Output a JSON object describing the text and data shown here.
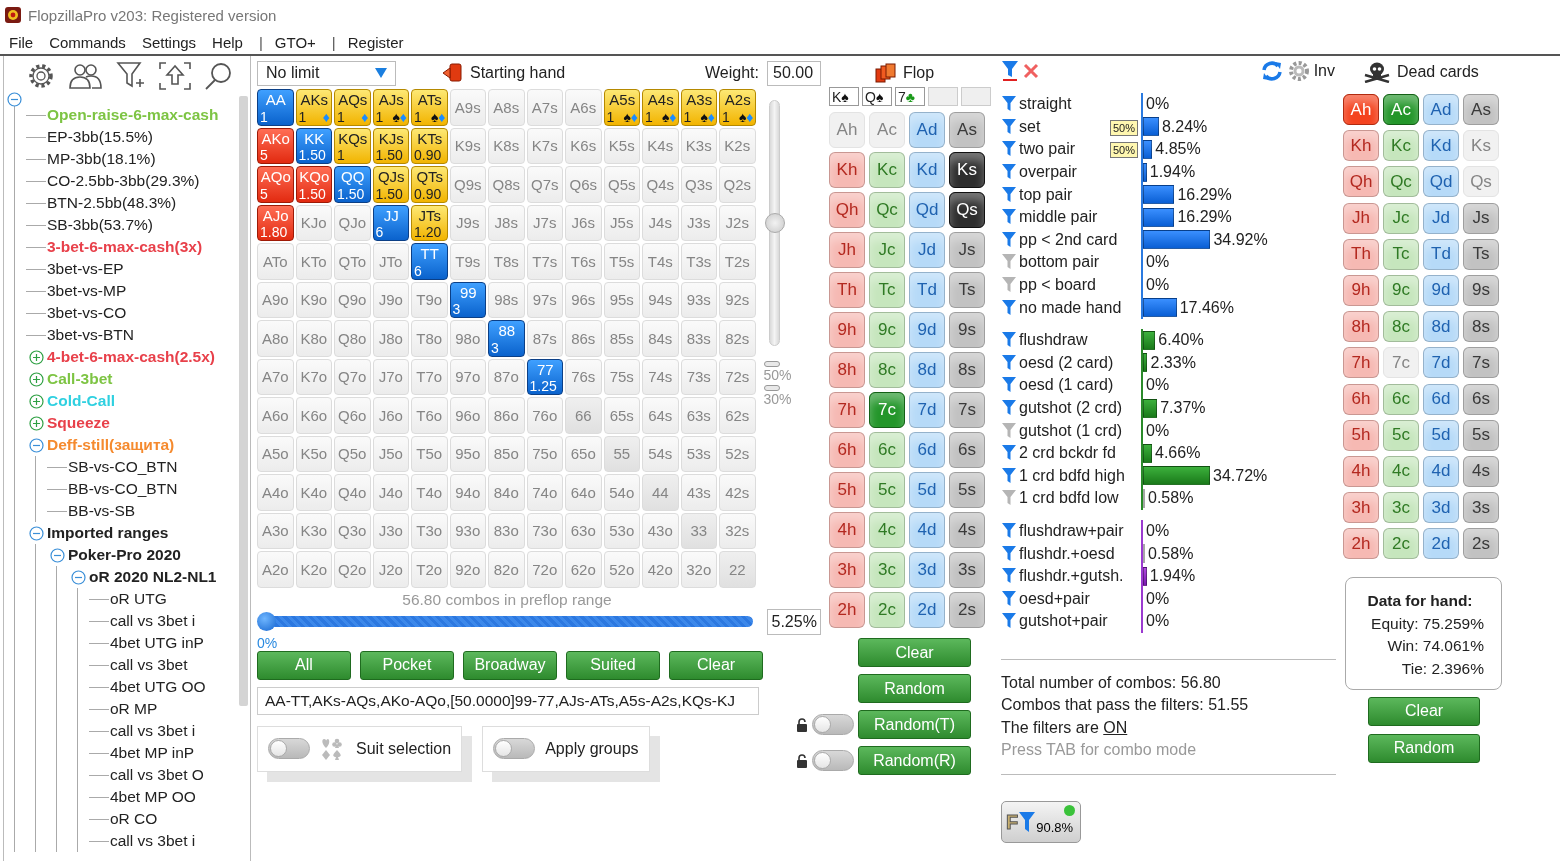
{
  "window": {
    "title": "FlopzillaPro v203: Registered version"
  },
  "menu": [
    {
      "label": "File",
      "kind": "item"
    },
    {
      "label": "Commands",
      "kind": "item"
    },
    {
      "label": "Settings",
      "kind": "item"
    },
    {
      "label": "Help",
      "kind": "item"
    },
    {
      "label": "|",
      "kind": "separator"
    },
    {
      "label": "GTO+",
      "kind": "item"
    },
    {
      "label": "|",
      "kind": "separator"
    },
    {
      "label": "Register",
      "kind": "item"
    }
  ],
  "tree": {
    "expanded": true,
    "children": [
      {
        "label": "Open-raise-6-max-cash",
        "kind": "group",
        "color": "#7dc443"
      },
      {
        "label": "EP-3bb(15.5%)",
        "kind": "range"
      },
      {
        "label": "MP-3bb(18.1%)",
        "kind": "range"
      },
      {
        "label": "CO-2.5bb-3bb(29.3%)",
        "kind": "range"
      },
      {
        "label": "BTN-2.5bb(48.3%)",
        "kind": "range"
      },
      {
        "label": "SB-3bb(53.7%)",
        "kind": "range"
      },
      {
        "label": "3-bet-6-max-cash(3x)",
        "kind": "group",
        "color": "#e8404a"
      },
      {
        "label": "3bet-vs-EP",
        "kind": "range"
      },
      {
        "label": "3bet-vs-MP",
        "kind": "range"
      },
      {
        "label": "3bet-vs-CO",
        "kind": "range"
      },
      {
        "label": "3bet-vs-BTN",
        "kind": "range"
      },
      {
        "label": "4-bet-6-max-cash(2.5x)",
        "kind": "group",
        "color": "#e8404a",
        "expanded": false
      },
      {
        "label": "Call-3bet",
        "kind": "group",
        "color": "#7dc443",
        "expanded": false
      },
      {
        "label": "Cold-Call",
        "kind": "group",
        "color": "#2fd0e0",
        "expanded": false
      },
      {
        "label": "Squeeze",
        "kind": "group",
        "color": "#e8404a",
        "expanded": false
      },
      {
        "label": "Deff-still(защита)",
        "kind": "group",
        "color": "#f58a2e",
        "expanded": true,
        "children": [
          {
            "label": "SB-vs-CO_BTN",
            "kind": "range"
          },
          {
            "label": "BB-vs-CO_BTN",
            "kind": "range"
          },
          {
            "label": "BB-vs-SB",
            "kind": "range"
          }
        ]
      },
      {
        "label": "Imported ranges",
        "kind": "group",
        "color": "#222222",
        "expanded": true,
        "children": [
          {
            "label": "Poker-Pro 2020",
            "kind": "group",
            "color": "#222222",
            "expanded": true,
            "children": [
              {
                "label": "oR 2020 NL2-NL1",
                "kind": "group",
                "color": "#222222",
                "expanded": true,
                "children": [
                  {
                    "label": "oR UTG",
                    "kind": "range"
                  },
                  {
                    "label": "call vs 3bet i",
                    "kind": "range"
                  },
                  {
                    "label": "4bet UTG inP",
                    "kind": "range"
                  },
                  {
                    "label": "call  vs 3bet",
                    "kind": "range"
                  },
                  {
                    "label": "4bet UTG OO",
                    "kind": "range"
                  },
                  {
                    "label": "oR MP",
                    "kind": "range"
                  },
                  {
                    "label": "call vs 3bet i",
                    "kind": "range"
                  },
                  {
                    "label": "4bet MP inP",
                    "kind": "range"
                  },
                  {
                    "label": "call vs 3bet O",
                    "kind": "range"
                  },
                  {
                    "label": "4bet MP OO",
                    "kind": "range"
                  },
                  {
                    "label": "oR CO",
                    "kind": "range"
                  },
                  {
                    "label": "call vs 3bet i",
                    "kind": "range"
                  }
                ]
              }
            ]
          }
        ]
      }
    ]
  },
  "hands": {
    "game": "No limit",
    "title": "Starting hand",
    "weight_label": "Weight:",
    "weight": "50.00",
    "grid": [
      [
        {
          "label": "AA",
          "in_range": true,
          "weight": "1"
        },
        {
          "label": "AKs",
          "in_range": true,
          "weight": "1",
          "suits": [
            {
              "glyph": "♦",
              "kind": "diamonds"
            }
          ]
        },
        {
          "label": "AQs",
          "in_range": true,
          "weight": "1",
          "suits": [
            {
              "glyph": "♦",
              "kind": "diamonds"
            }
          ]
        },
        {
          "label": "AJs",
          "in_range": true,
          "weight": "1",
          "suits": [
            {
              "glyph": "♠",
              "kind": "spades"
            },
            {
              "glyph": "♦",
              "kind": "diamonds"
            }
          ]
        },
        {
          "label": "ATs",
          "in_range": true,
          "weight": "1",
          "suits": [
            {
              "glyph": "♠",
              "kind": "spades"
            },
            {
              "glyph": "♦",
              "kind": "diamonds"
            }
          ]
        },
        {
          "label": "A9s",
          "in_range": false
        },
        {
          "label": "A8s",
          "in_range": false
        },
        {
          "label": "A7s",
          "in_range": false
        },
        {
          "label": "A6s",
          "in_range": false
        },
        {
          "label": "A5s",
          "in_range": true,
          "weight": "1",
          "suits": [
            {
              "glyph": "♠",
              "kind": "spades"
            },
            {
              "glyph": "♦",
              "kind": "diamonds"
            }
          ]
        },
        {
          "label": "A4s",
          "in_range": true,
          "weight": "1",
          "suits": [
            {
              "glyph": "♠",
              "kind": "spades"
            },
            {
              "glyph": "♦",
              "kind": "diamonds"
            }
          ]
        },
        {
          "label": "A3s",
          "in_range": true,
          "weight": "1",
          "suits": [
            {
              "glyph": "♠",
              "kind": "spades"
            },
            {
              "glyph": "♦",
              "kind": "diamonds"
            }
          ]
        },
        {
          "label": "A2s",
          "in_range": true,
          "weight": "1",
          "suits": [
            {
              "glyph": "♠",
              "kind": "spades"
            },
            {
              "glyph": "♦",
              "kind": "diamonds"
            }
          ]
        }
      ],
      [
        {
          "label": "AKo",
          "in_range": true,
          "weight": "5"
        },
        {
          "label": "KK",
          "in_range": true,
          "weight": "1.50"
        },
        {
          "label": "KQs",
          "in_range": true,
          "weight": "1"
        },
        {
          "label": "KJs",
          "in_range": true,
          "weight": "1.50"
        },
        {
          "label": "KTs",
          "in_range": true,
          "weight": "0.90"
        },
        {
          "label": "K9s",
          "in_range": false
        },
        {
          "label": "K8s",
          "in_range": false
        },
        {
          "label": "K7s",
          "in_range": false
        },
        {
          "label": "K6s",
          "in_range": false
        },
        {
          "label": "K5s",
          "in_range": false
        },
        {
          "label": "K4s",
          "in_range": false
        },
        {
          "label": "K3s",
          "in_range": false
        },
        {
          "label": "K2s",
          "in_range": false
        }
      ],
      [
        {
          "label": "AQo",
          "in_range": true,
          "weight": "5"
        },
        {
          "label": "KQo",
          "in_range": true,
          "weight": "1.50"
        },
        {
          "label": "QQ",
          "in_range": true,
          "weight": "1.50"
        },
        {
          "label": "QJs",
          "in_range": true,
          "weight": "1.50"
        },
        {
          "label": "QTs",
          "in_range": true,
          "weight": "0.90"
        },
        {
          "label": "Q9s",
          "in_range": false
        },
        {
          "label": "Q8s",
          "in_range": false
        },
        {
          "label": "Q7s",
          "in_range": false
        },
        {
          "label": "Q6s",
          "in_range": false
        },
        {
          "label": "Q5s",
          "in_range": false
        },
        {
          "label": "Q4s",
          "in_range": false
        },
        {
          "label": "Q3s",
          "in_range": false
        },
        {
          "label": "Q2s",
          "in_range": false
        }
      ],
      [
        {
          "label": "AJo",
          "in_range": true,
          "weight": "1.80"
        },
        {
          "label": "KJo",
          "in_range": false
        },
        {
          "label": "QJo",
          "in_range": false
        },
        {
          "label": "JJ",
          "in_range": true,
          "weight": "6"
        },
        {
          "label": "JTs",
          "in_range": true,
          "weight": "1.20"
        },
        {
          "label": "J9s",
          "in_range": false
        },
        {
          "label": "J8s",
          "in_range": false
        },
        {
          "label": "J7s",
          "in_range": false
        },
        {
          "label": "J6s",
          "in_range": false
        },
        {
          "label": "J5s",
          "in_range": false
        },
        {
          "label": "J4s",
          "in_range": false
        },
        {
          "label": "J3s",
          "in_range": false
        },
        {
          "label": "J2s",
          "in_range": false
        }
      ],
      [
        {
          "label": "ATo",
          "in_range": false
        },
        {
          "label": "KTo",
          "in_range": false
        },
        {
          "label": "QTo",
          "in_range": false
        },
        {
          "label": "JTo",
          "in_range": false
        },
        {
          "label": "TT",
          "in_range": true,
          "weight": "6"
        },
        {
          "label": "T9s",
          "in_range": false
        },
        {
          "label": "T8s",
          "in_range": false
        },
        {
          "label": "T7s",
          "in_range": false
        },
        {
          "label": "T6s",
          "in_range": false
        },
        {
          "label": "T5s",
          "in_range": false
        },
        {
          "label": "T4s",
          "in_range": false
        },
        {
          "label": "T3s",
          "in_range": false
        },
        {
          "label": "T2s",
          "in_range": false
        }
      ],
      [
        {
          "label": "A9o",
          "in_range": false
        },
        {
          "label": "K9o",
          "in_range": false
        },
        {
          "label": "Q9o",
          "in_range": false
        },
        {
          "label": "J9o",
          "in_range": false
        },
        {
          "label": "T9o",
          "in_range": false
        },
        {
          "label": "99",
          "in_range": true,
          "weight": "3"
        },
        {
          "label": "98s",
          "in_range": false
        },
        {
          "label": "97s",
          "in_range": false
        },
        {
          "label": "96s",
          "in_range": false
        },
        {
          "label": "95s",
          "in_range": false
        },
        {
          "label": "94s",
          "in_range": false
        },
        {
          "label": "93s",
          "in_range": false
        },
        {
          "label": "92s",
          "in_range": false
        }
      ],
      [
        {
          "label": "A8o",
          "in_range": false
        },
        {
          "label": "K8o",
          "in_range": false
        },
        {
          "label": "Q8o",
          "in_range": false
        },
        {
          "label": "J8o",
          "in_range": false
        },
        {
          "label": "T8o",
          "in_range": false
        },
        {
          "label": "98o",
          "in_range": false
        },
        {
          "label": "88",
          "in_range": true,
          "weight": "3"
        },
        {
          "label": "87s",
          "in_range": false
        },
        {
          "label": "86s",
          "in_range": false
        },
        {
          "label": "85s",
          "in_range": false
        },
        {
          "label": "84s",
          "in_range": false
        },
        {
          "label": "83s",
          "in_range": false
        },
        {
          "label": "82s",
          "in_range": false
        }
      ],
      [
        {
          "label": "A7o",
          "in_range": false
        },
        {
          "label": "K7o",
          "in_range": false
        },
        {
          "label": "Q7o",
          "in_range": false
        },
        {
          "label": "J7o",
          "in_range": false
        },
        {
          "label": "T7o",
          "in_range": false
        },
        {
          "label": "97o",
          "in_range": false
        },
        {
          "label": "87o",
          "in_range": false
        },
        {
          "label": "77",
          "in_range": true,
          "weight": "1.25"
        },
        {
          "label": "76s",
          "in_range": false
        },
        {
          "label": "75s",
          "in_range": false
        },
        {
          "label": "74s",
          "in_range": false
        },
        {
          "label": "73s",
          "in_range": false
        },
        {
          "label": "72s",
          "in_range": false
        }
      ],
      [
        {
          "label": "A6o",
          "in_range": false
        },
        {
          "label": "K6o",
          "in_range": false
        },
        {
          "label": "Q6o",
          "in_range": false
        },
        {
          "label": "J6o",
          "in_range": false
        },
        {
          "label": "T6o",
          "in_range": false
        },
        {
          "label": "96o",
          "in_range": false
        },
        {
          "label": "86o",
          "in_range": false
        },
        {
          "label": "76o",
          "in_range": false
        },
        {
          "label": "66",
          "in_range": false
        },
        {
          "label": "65s",
          "in_range": false
        },
        {
          "label": "64s",
          "in_range": false
        },
        {
          "label": "63s",
          "in_range": false
        },
        {
          "label": "62s",
          "in_range": false
        }
      ],
      [
        {
          "label": "A5o",
          "in_range": false
        },
        {
          "label": "K5o",
          "in_range": false
        },
        {
          "label": "Q5o",
          "in_range": false
        },
        {
          "label": "J5o",
          "in_range": false
        },
        {
          "label": "T5o",
          "in_range": false
        },
        {
          "label": "95o",
          "in_range": false
        },
        {
          "label": "85o",
          "in_range": false
        },
        {
          "label": "75o",
          "in_range": false
        },
        {
          "label": "65o",
          "in_range": false
        },
        {
          "label": "55",
          "in_range": false
        },
        {
          "label": "54s",
          "in_range": false
        },
        {
          "label": "53s",
          "in_range": false
        },
        {
          "label": "52s",
          "in_range": false
        }
      ],
      [
        {
          "label": "A4o",
          "in_range": false
        },
        {
          "label": "K4o",
          "in_range": false
        },
        {
          "label": "Q4o",
          "in_range": false
        },
        {
          "label": "J4o",
          "in_range": false
        },
        {
          "label": "T4o",
          "in_range": false
        },
        {
          "label": "94o",
          "in_range": false
        },
        {
          "label": "84o",
          "in_range": false
        },
        {
          "label": "74o",
          "in_range": false
        },
        {
          "label": "64o",
          "in_range": false
        },
        {
          "label": "54o",
          "in_range": false
        },
        {
          "label": "44",
          "in_range": false
        },
        {
          "label": "43s",
          "in_range": false
        },
        {
          "label": "42s",
          "in_range": false
        }
      ],
      [
        {
          "label": "A3o",
          "in_range": false
        },
        {
          "label": "K3o",
          "in_range": false
        },
        {
          "label": "Q3o",
          "in_range": false
        },
        {
          "label": "J3o",
          "in_range": false
        },
        {
          "label": "T3o",
          "in_range": false
        },
        {
          "label": "93o",
          "in_range": false
        },
        {
          "label": "83o",
          "in_range": false
        },
        {
          "label": "73o",
          "in_range": false
        },
        {
          "label": "63o",
          "in_range": false
        },
        {
          "label": "53o",
          "in_range": false
        },
        {
          "label": "43o",
          "in_range": false
        },
        {
          "label": "33",
          "in_range": false
        },
        {
          "label": "32s",
          "in_range": false
        }
      ],
      [
        {
          "label": "A2o",
          "in_range": false
        },
        {
          "label": "K2o",
          "in_range": false
        },
        {
          "label": "Q2o",
          "in_range": false
        },
        {
          "label": "J2o",
          "in_range": false
        },
        {
          "label": "T2o",
          "in_range": false
        },
        {
          "label": "92o",
          "in_range": false
        },
        {
          "label": "82o",
          "in_range": false
        },
        {
          "label": "72o",
          "in_range": false
        },
        {
          "label": "62o",
          "in_range": false
        },
        {
          "label": "52o",
          "in_range": false
        },
        {
          "label": "42o",
          "in_range": false
        },
        {
          "label": "32o",
          "in_range": false
        },
        {
          "label": "22",
          "in_range": false
        }
      ]
    ],
    "vertical_slider": {
      "level": 0.5
    },
    "legend": [
      {
        "label": "50%"
      },
      {
        "label": "30%"
      }
    ],
    "combos_text": "56.80 combos in preflop range",
    "range_slider": {
      "level": 0,
      "min_label": "0%"
    },
    "range_percent": "5.25%",
    "buttons": [
      "All",
      "Pocket",
      "Broadway",
      "Suited",
      "Clear"
    ],
    "range_text": "AA-TT,AKs-AQs,AKo-AQo,[50.0000]99-77,AJs-ATs,A5s-A2s,KQs-KJ",
    "toggles": [
      {
        "label": "Suit selection",
        "on": false,
        "kind": "suits"
      },
      {
        "label": "Apply groups",
        "on": false,
        "kind": "plain"
      }
    ]
  },
  "flop": {
    "title": "Flop",
    "board": [
      {
        "kind": "card",
        "rank": "K",
        "suit": "♠",
        "color": "#111111"
      },
      {
        "kind": "card",
        "rank": "Q",
        "suit": "♠",
        "color": "#111111"
      },
      {
        "kind": "card",
        "rank": "7",
        "suit": "♣",
        "color": "#1a9a1a"
      },
      {
        "kind": "empty"
      },
      {
        "kind": "empty"
      }
    ],
    "cards": [
      [
        {
          "label": "Ah",
          "selected": false,
          "disabled": true
        },
        {
          "label": "Ac",
          "selected": false,
          "disabled": true
        },
        {
          "label": "Ad",
          "selected": false,
          "disabled": false
        },
        {
          "label": "As",
          "selected": false,
          "disabled": false
        }
      ],
      [
        {
          "label": "Kh",
          "selected": false,
          "disabled": false
        },
        {
          "label": "Kc",
          "selected": false,
          "disabled": false
        },
        {
          "label": "Kd",
          "selected": false,
          "disabled": false
        },
        {
          "label": "Ks",
          "selected": true,
          "disabled": false
        }
      ],
      [
        {
          "label": "Qh",
          "selected": false,
          "disabled": false
        },
        {
          "label": "Qc",
          "selected": false,
          "disabled": false
        },
        {
          "label": "Qd",
          "selected": false,
          "disabled": false
        },
        {
          "label": "Qs",
          "selected": true,
          "disabled": false
        }
      ],
      [
        {
          "label": "Jh",
          "selected": false,
          "disabled": false
        },
        {
          "label": "Jc",
          "selected": false,
          "disabled": false
        },
        {
          "label": "Jd",
          "selected": false,
          "disabled": false
        },
        {
          "label": "Js",
          "selected": false,
          "disabled": false
        }
      ],
      [
        {
          "label": "Th",
          "selected": false,
          "disabled": false
        },
        {
          "label": "Tc",
          "selected": false,
          "disabled": false
        },
        {
          "label": "Td",
          "selected": false,
          "disabled": false
        },
        {
          "label": "Ts",
          "selected": false,
          "disabled": false
        }
      ],
      [
        {
          "label": "9h",
          "selected": false,
          "disabled": false
        },
        {
          "label": "9c",
          "selected": false,
          "disabled": false
        },
        {
          "label": "9d",
          "selected": false,
          "disabled": false
        },
        {
          "label": "9s",
          "selected": false,
          "disabled": false
        }
      ],
      [
        {
          "label": "8h",
          "selected": false,
          "disabled": false
        },
        {
          "label": "8c",
          "selected": false,
          "disabled": false
        },
        {
          "label": "8d",
          "selected": false,
          "disabled": false
        },
        {
          "label": "8s",
          "selected": false,
          "disabled": false
        }
      ],
      [
        {
          "label": "7h",
          "selected": false,
          "disabled": false
        },
        {
          "label": "7c",
          "selected": true,
          "disabled": false
        },
        {
          "label": "7d",
          "selected": false,
          "disabled": false
        },
        {
          "label": "7s",
          "selected": false,
          "disabled": false
        }
      ],
      [
        {
          "label": "6h",
          "selected": false,
          "disabled": false
        },
        {
          "label": "6c",
          "selected": false,
          "disabled": false
        },
        {
          "label": "6d",
          "selected": false,
          "disabled": false
        },
        {
          "label": "6s",
          "selected": false,
          "disabled": false
        }
      ],
      [
        {
          "label": "5h",
          "selected": false,
          "disabled": false
        },
        {
          "label": "5c",
          "selected": false,
          "disabled": false
        },
        {
          "label": "5d",
          "selected": false,
          "disabled": false
        },
        {
          "label": "5s",
          "selected": false,
          "disabled": false
        }
      ],
      [
        {
          "label": "4h",
          "selected": false,
          "disabled": false
        },
        {
          "label": "4c",
          "selected": false,
          "disabled": false
        },
        {
          "label": "4d",
          "selected": false,
          "disabled": false
        },
        {
          "label": "4s",
          "selected": false,
          "disabled": false
        }
      ],
      [
        {
          "label": "3h",
          "selected": false,
          "disabled": false
        },
        {
          "label": "3c",
          "selected": false,
          "disabled": false
        },
        {
          "label": "3d",
          "selected": false,
          "disabled": false
        },
        {
          "label": "3s",
          "selected": false,
          "disabled": false
        }
      ],
      [
        {
          "label": "2h",
          "selected": false,
          "disabled": false
        },
        {
          "label": "2c",
          "selected": false,
          "disabled": false
        },
        {
          "label": "2d",
          "selected": false,
          "disabled": false
        },
        {
          "label": "2s",
          "selected": false,
          "disabled": false
        }
      ]
    ],
    "buttons": [
      {
        "label": "Clear"
      },
      {
        "label": "Random"
      },
      {
        "label": "Random(T)",
        "toggle": {
          "on": false
        }
      },
      {
        "label": "Random(R)",
        "toggle": {
          "on": false
        }
      }
    ]
  },
  "filters": {
    "inv_label": "Inv",
    "groups": [
      {
        "kind": "made",
        "items": [
          {
            "label": "straight",
            "active": true,
            "value": "0%"
          },
          {
            "label": "set",
            "active": true,
            "badge": "50%",
            "value": "8.24%",
            "level": 0.0824
          },
          {
            "label": "two pair",
            "active": true,
            "badge": "50%",
            "value": "4.85%",
            "level": 0.0485
          },
          {
            "label": "overpair",
            "active": true,
            "value": "1.94%",
            "level": 0.0194
          },
          {
            "label": "top pair",
            "active": true,
            "value": "16.29%",
            "level": 0.1629
          },
          {
            "label": "middle pair",
            "active": true,
            "value": "16.29%",
            "level": 0.1629
          },
          {
            "label": "pp < 2nd card",
            "active": true,
            "value": "34.92%",
            "level": 0.3492
          },
          {
            "label": "bottom pair",
            "active": false,
            "value": "0%"
          },
          {
            "label": "pp < board",
            "active": false,
            "value": "0%"
          },
          {
            "label": "no made hand",
            "active": true,
            "value": "17.46%",
            "level": 0.1746
          }
        ]
      },
      {
        "kind": "draw",
        "items": [
          {
            "label": "flushdraw",
            "active": true,
            "value": "6.40%",
            "level": 0.064
          },
          {
            "label": "oesd (2 card)",
            "active": true,
            "value": "2.33%",
            "level": 0.0233
          },
          {
            "label": "oesd (1 card)",
            "active": true,
            "value": "0%"
          },
          {
            "label": "gutshot (2 crd)",
            "active": true,
            "value": "7.37%",
            "level": 0.0737
          },
          {
            "label": "gutshot (1 crd)",
            "active": false,
            "value": "0%"
          },
          {
            "label": "2 crd bckdr fd",
            "active": true,
            "value": "4.66%",
            "level": 0.0466
          },
          {
            "label": "1 crd bdfd high",
            "active": true,
            "value": "34.72%",
            "level": 0.3472
          },
          {
            "label": "1 crd bdfd low",
            "active": false,
            "value": "0.58%",
            "level": 0.0058
          }
        ]
      },
      {
        "kind": "combo",
        "items": [
          {
            "label": "flushdraw+pair",
            "active": true,
            "value": "0%"
          },
          {
            "label": "flushdr.+oesd",
            "active": true,
            "value": "0.58%",
            "level": 0.0058
          },
          {
            "label": "flushdr.+gutsh.",
            "active": true,
            "value": "1.94%",
            "level": 0.0194
          },
          {
            "label": "oesd+pair",
            "active": true,
            "value": "0%"
          },
          {
            "label": "gutshot+pair",
            "active": true,
            "value": "0%"
          }
        ]
      }
    ],
    "summary": [
      "Total number of combos: 56.80",
      "Combos that pass the filters: 51.55"
    ],
    "state_text": "The filters are",
    "state_link": "ON",
    "hint": "Press TAB for combo mode",
    "filter_button": {
      "label": "F",
      "value": "90.8%",
      "on": true
    }
  },
  "dead": {
    "title": "Dead cards",
    "cards": [
      [
        {
          "label": "Ah",
          "selected": true,
          "disabled": false
        },
        {
          "label": "Ac",
          "selected": true,
          "disabled": false
        },
        {
          "label": "Ad",
          "selected": false,
          "disabled": false
        },
        {
          "label": "As",
          "selected": false,
          "disabled": false
        }
      ],
      [
        {
          "label": "Kh",
          "selected": false,
          "disabled": false
        },
        {
          "label": "Kc",
          "selected": false,
          "disabled": false
        },
        {
          "label": "Kd",
          "selected": false,
          "disabled": false
        },
        {
          "label": "Ks",
          "selected": false,
          "disabled": true
        }
      ],
      [
        {
          "label": "Qh",
          "selected": false,
          "disabled": false
        },
        {
          "label": "Qc",
          "selected": false,
          "disabled": false
        },
        {
          "label": "Qd",
          "selected": false,
          "disabled": false
        },
        {
          "label": "Qs",
          "selected": false,
          "disabled": true
        }
      ],
      [
        {
          "label": "Jh",
          "selected": false,
          "disabled": false
        },
        {
          "label": "Jc",
          "selected": false,
          "disabled": false
        },
        {
          "label": "Jd",
          "selected": false,
          "disabled": false
        },
        {
          "label": "Js",
          "selected": false,
          "disabled": false
        }
      ],
      [
        {
          "label": "Th",
          "selected": false,
          "disabled": false
        },
        {
          "label": "Tc",
          "selected": false,
          "disabled": false
        },
        {
          "label": "Td",
          "selected": false,
          "disabled": false
        },
        {
          "label": "Ts",
          "selected": false,
          "disabled": false
        }
      ],
      [
        {
          "label": "9h",
          "selected": false,
          "disabled": false
        },
        {
          "label": "9c",
          "selected": false,
          "disabled": false
        },
        {
          "label": "9d",
          "selected": false,
          "disabled": false
        },
        {
          "label": "9s",
          "selected": false,
          "disabled": false
        }
      ],
      [
        {
          "label": "8h",
          "selected": false,
          "disabled": false
        },
        {
          "label": "8c",
          "selected": false,
          "disabled": false
        },
        {
          "label": "8d",
          "selected": false,
          "disabled": false
        },
        {
          "label": "8s",
          "selected": false,
          "disabled": false
        }
      ],
      [
        {
          "label": "7h",
          "selected": false,
          "disabled": false
        },
        {
          "label": "7c",
          "selected": false,
          "disabled": true
        },
        {
          "label": "7d",
          "selected": false,
          "disabled": false
        },
        {
          "label": "7s",
          "selected": false,
          "disabled": false
        }
      ],
      [
        {
          "label": "6h",
          "selected": false,
          "disabled": false
        },
        {
          "label": "6c",
          "selected": false,
          "disabled": false
        },
        {
          "label": "6d",
          "selected": false,
          "disabled": false
        },
        {
          "label": "6s",
          "selected": false,
          "disabled": false
        }
      ],
      [
        {
          "label": "5h",
          "selected": false,
          "disabled": false
        },
        {
          "label": "5c",
          "selected": false,
          "disabled": false
        },
        {
          "label": "5d",
          "selected": false,
          "disabled": false
        },
        {
          "label": "5s",
          "selected": false,
          "disabled": false
        }
      ],
      [
        {
          "label": "4h",
          "selected": false,
          "disabled": false
        },
        {
          "label": "4c",
          "selected": false,
          "disabled": false
        },
        {
          "label": "4d",
          "selected": false,
          "disabled": false
        },
        {
          "label": "4s",
          "selected": false,
          "disabled": false
        }
      ],
      [
        {
          "label": "3h",
          "selected": false,
          "disabled": false
        },
        {
          "label": "3c",
          "selected": false,
          "disabled": false
        },
        {
          "label": "3d",
          "selected": false,
          "disabled": false
        },
        {
          "label": "3s",
          "selected": false,
          "disabled": false
        }
      ],
      [
        {
          "label": "2h",
          "selected": false,
          "disabled": false
        },
        {
          "label": "2c",
          "selected": false,
          "disabled": false
        },
        {
          "label": "2d",
          "selected": false,
          "disabled": false
        },
        {
          "label": "2s",
          "selected": false,
          "disabled": false
        }
      ]
    ],
    "data_title": "Data for hand:",
    "stats": [
      "Equity: 75.259%",
      "Win: 74.061%",
      "Tie: 2.396%"
    ],
    "buttons": [
      "Clear",
      "Random"
    ]
  }
}
